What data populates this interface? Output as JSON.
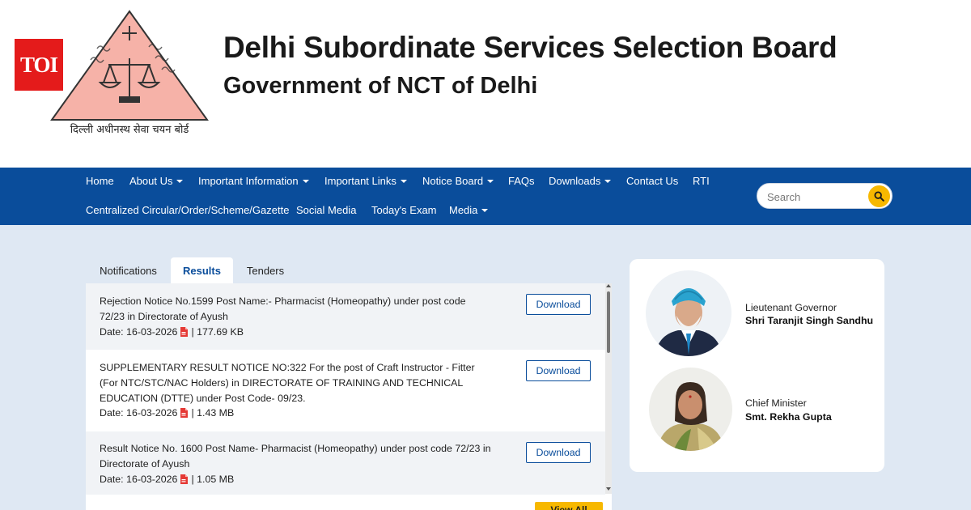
{
  "header": {
    "toi_logo_text": "TOI",
    "emblem_caption": "दिल्ली अधीनस्थ सेवा चयन बोर्ड",
    "title": "Delhi Subordinate Services Selection Board",
    "subtitle": "Government of NCT of Delhi"
  },
  "nav": {
    "row1": [
      {
        "label": "Home",
        "dropdown": false
      },
      {
        "label": "About Us",
        "dropdown": true
      },
      {
        "label": "Important Information",
        "dropdown": true
      },
      {
        "label": "Important Links",
        "dropdown": true
      },
      {
        "label": "Notice Board",
        "dropdown": true
      },
      {
        "label": "FAQs",
        "dropdown": false
      },
      {
        "label": "Downloads",
        "dropdown": true
      },
      {
        "label": "Contact Us",
        "dropdown": false
      },
      {
        "label": "RTI",
        "dropdown": false
      }
    ],
    "row2": [
      {
        "label": "Centralized Circular/Order/Scheme/Gazette",
        "dropdown": false
      },
      {
        "label": "Social Media",
        "dropdown": false
      },
      {
        "label": "Today's Exam",
        "dropdown": false
      },
      {
        "label": "Media",
        "dropdown": true
      }
    ],
    "search": {
      "placeholder": "Search",
      "value": ""
    }
  },
  "tabs": [
    {
      "label": "Notifications",
      "active": false
    },
    {
      "label": "Results",
      "active": true
    },
    {
      "label": "Tenders",
      "active": false
    }
  ],
  "notices": [
    {
      "title": "Rejection Notice No.1599 Post Name:- Pharmacist (Homeopathy) under post code 72/23 in Directorate of Ayush",
      "date": "Date: 16-03-2026",
      "size": "| 177.69 KB",
      "button": "Download"
    },
    {
      "title": "SUPPLEMENTARY RESULT NOTICE NO:322 For the post of Craft Instructor - Fitter (For NTC/STC/NAC Holders) in DIRECTORATE OF TRAINING AND TECHNICAL EDUCATION (DTTE) under Post Code- 09/23.",
      "date": "Date: 16-03-2026",
      "size": "| 1.43 MB",
      "button": "Download"
    },
    {
      "title": "Result Notice No. 1600 Post Name- Pharmacist (Homeopathy) under post code 72/23 in Directorate of Ayush",
      "date": "Date: 16-03-2026",
      "size": "| 1.05 MB",
      "button": "Download"
    }
  ],
  "view_all_label": "View All",
  "dignitaries": [
    {
      "role": "Lieutenant Governor",
      "name": "Shri Taranjit Singh Sandhu"
    },
    {
      "role": "Chief Minister",
      "name": "Smt. Rekha Gupta"
    }
  ],
  "colors": {
    "nav_bg": "#0a4d9b",
    "accent_yellow": "#f7b800",
    "toi_red": "#e41b1b",
    "page_bg": "#dfe8f3",
    "emblem_fill": "#f6b2a8"
  },
  "icons": [
    "caret-down-icon",
    "search-icon",
    "pdf-icon",
    "scales-icon",
    "cross-icon"
  ]
}
